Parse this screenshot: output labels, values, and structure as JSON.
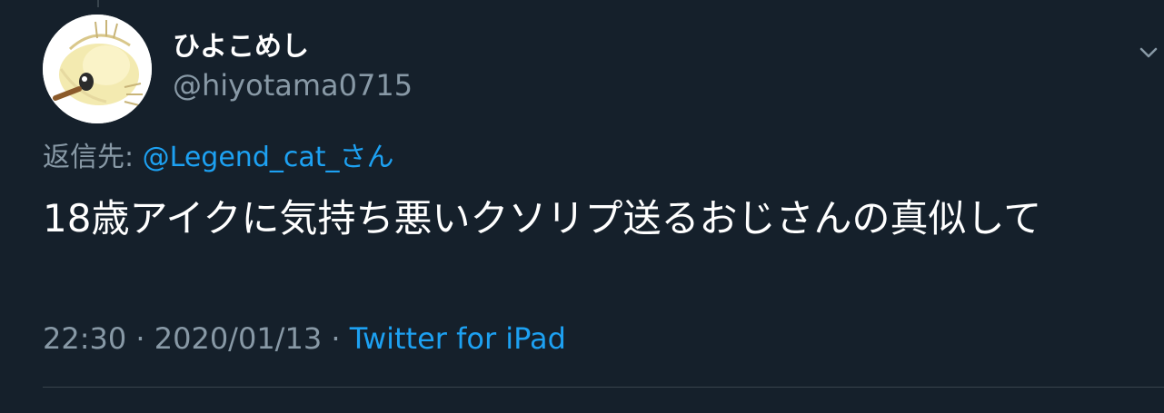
{
  "tweet": {
    "author": {
      "display_name": "ひよこめし",
      "handle": "@hiyotama0715",
      "avatar_icon": "avatar-image"
    },
    "reply": {
      "prefix": "返信先: ",
      "mention": "@Legend_cat_",
      "suffix": "さん"
    },
    "text": "18歳アイクに気持ち悪いクソリプ送るおじさんの真似して",
    "meta": {
      "time": "22:30",
      "separator": " · ",
      "date": "2020/01/13",
      "source": "Twitter for iPad"
    },
    "menu_icon": "chevron-down-icon"
  },
  "colors": {
    "background": "#15202b",
    "text_primary": "#ffffff",
    "text_secondary": "#8899a6",
    "accent": "#1da1f2",
    "divider": "#38444d"
  }
}
